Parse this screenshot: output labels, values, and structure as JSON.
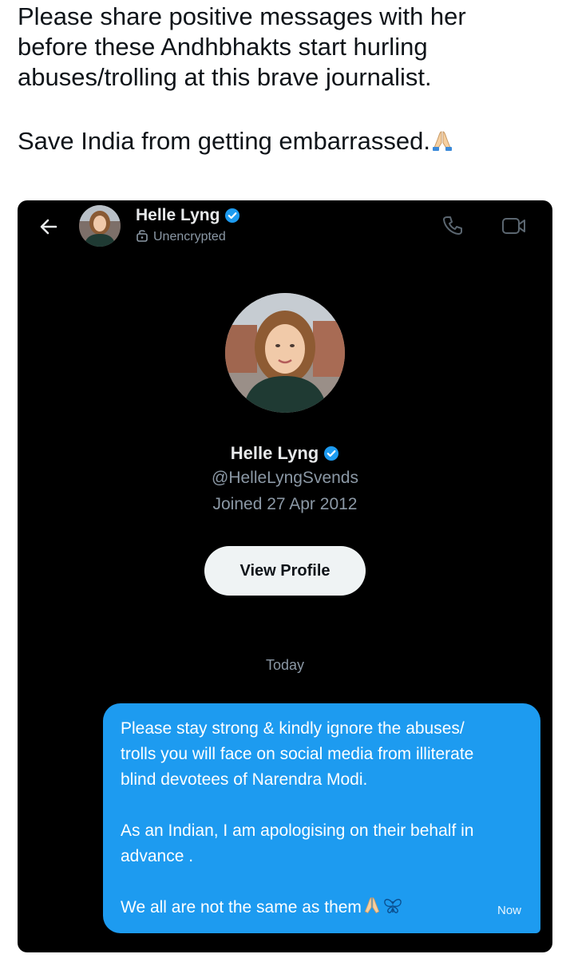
{
  "post": {
    "line1": "Please share positive messages with her",
    "line2": "before these Andhbhakts start hurling",
    "line3": "abuses/trolling at this brave journalist.",
    "line4": "Save India from getting embarrassed.",
    "emoji": "folded-hands"
  },
  "chat_header": {
    "name": "Helle Lyng",
    "status": "Unencrypted",
    "icons": [
      "back-arrow-icon",
      "lock-icon",
      "verified-badge-icon",
      "phone-icon",
      "video-icon"
    ]
  },
  "profile": {
    "name": "Helle Lyng",
    "handle": "@HelleLyngSvends",
    "joined": "Joined 27 Apr 2012",
    "view_button": "View Profile"
  },
  "conversation": {
    "date_separator": "Today",
    "message": {
      "line1": "Please stay strong & kindly ignore the abuses/",
      "line2": "trolls you will face on social media from illiterate",
      "line3": "blind devotees of Narendra Modi.",
      "line4": "As an Indian, I am apologising on their behalf in",
      "line5": "advance .",
      "line6": "We all are not the same as them",
      "time": "Now"
    }
  },
  "colors": {
    "accent": "#1d9bf0",
    "background_dark": "#000000",
    "muted_text": "#8b98a5"
  }
}
